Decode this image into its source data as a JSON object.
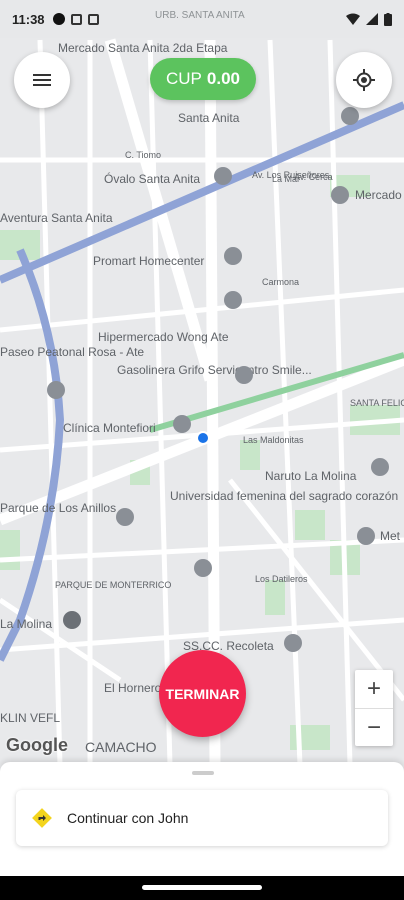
{
  "status_bar": {
    "time": "11:38"
  },
  "balance": {
    "currency": "CUP",
    "amount": "0.00"
  },
  "finish_button": {
    "label": "TERMINAR"
  },
  "zoom": {
    "in": "+",
    "out": "−"
  },
  "map": {
    "attribution": "Google",
    "places": [
      "Mercado Santa Anita 2da Etapa",
      "URB. SANTA ANITA",
      "Santa Anita",
      "Óvalo Santa Anita",
      "C. Tiomo",
      "Av. Los Ruiseñores",
      "Av. Cerca",
      "La Mar",
      "Mercado",
      "Aventura Santa Anita",
      "Promart Homecenter",
      "Carmona",
      "Hipermercado Wong Ate",
      "Gasolinera Grifo Servicentro Smile...",
      "Paseo Peatonal Rosa - Ate",
      "Clínica Montefiori",
      "Las Maldonitas",
      "SANTA FELICIA",
      "Naruto La Molina",
      "Universidad femenina del sagrado corazón",
      "Parque de Los Anillos",
      "Los Datileros",
      "PARQUE DE MONTERRICO",
      "La Molina",
      "SS.CC. Recoleta",
      "El Hornero",
      "KLIN VEFL",
      "CAMACHO",
      "Met"
    ]
  },
  "sheet": {
    "continue_label": "Continuar con John"
  },
  "icons": {
    "menu": "hamburger-icon",
    "location": "gps-target-icon",
    "continue": "directions-icon"
  }
}
